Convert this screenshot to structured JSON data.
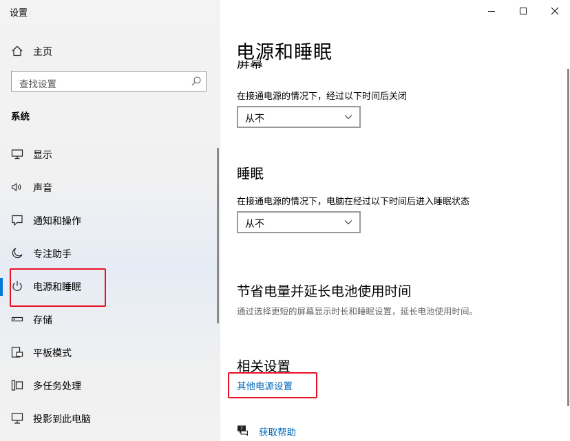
{
  "app": {
    "title": "设置"
  },
  "sidebar": {
    "home_label": "主页",
    "search_placeholder": "查找设置",
    "group_title": "系统",
    "items": [
      {
        "label": "显示",
        "icon": "monitor-icon"
      },
      {
        "label": "声音",
        "icon": "speaker-icon"
      },
      {
        "label": "通知和操作",
        "icon": "notification-icon"
      },
      {
        "label": "专注助手",
        "icon": "moon-icon"
      },
      {
        "label": "电源和睡眠",
        "icon": "power-icon",
        "selected": true
      },
      {
        "label": "存储",
        "icon": "storage-icon"
      },
      {
        "label": "平板模式",
        "icon": "tablet-icon"
      },
      {
        "label": "多任务处理",
        "icon": "multitask-icon"
      },
      {
        "label": "投影到此电脑",
        "icon": "project-icon"
      }
    ]
  },
  "main": {
    "title": "电源和睡眠",
    "screen_heading_partial": "屏幕",
    "screen": {
      "desc": "在接通电源的情况下，经过以下时间后关闭",
      "value": "从不"
    },
    "sleep": {
      "heading": "睡眠",
      "desc": "在接通电源的情况下，电脑在经过以下时间后进入睡眠状态",
      "value": "从不"
    },
    "battery": {
      "heading": "节省电量并延长电池使用时间",
      "desc": "通过选择更短的屏幕显示时长和睡眠设置，延长电池使用时间。"
    },
    "related": {
      "heading": "相关设置",
      "link": "其他电源设置"
    },
    "help": {
      "link": "获取帮助"
    }
  },
  "colors": {
    "accent": "#0078d7",
    "link": "#0067b8",
    "highlight": "#e81123"
  }
}
